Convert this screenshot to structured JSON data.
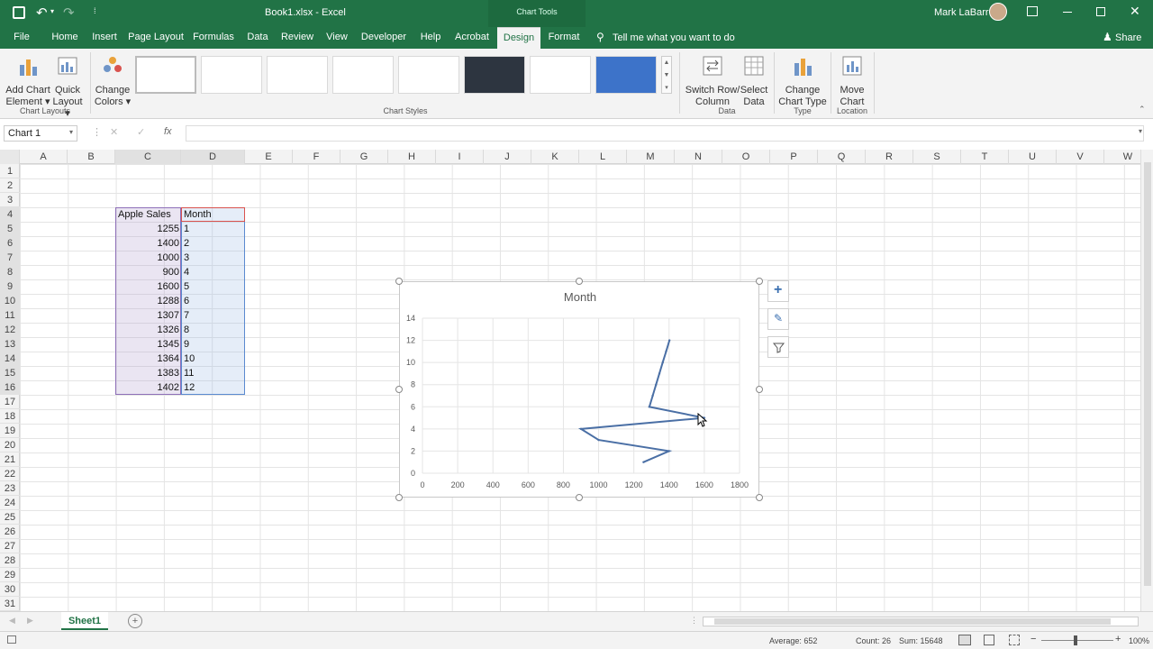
{
  "titlebar": {
    "filename": "Book1.xlsx - Excel",
    "contextual": "Chart Tools",
    "user": "Mark LaBarr"
  },
  "tabs": [
    "File",
    "Home",
    "Insert",
    "Page Layout",
    "Formulas",
    "Data",
    "Review",
    "View",
    "Developer",
    "Help",
    "Acrobat",
    "Design",
    "Format"
  ],
  "tell_me": "Tell me what you want to do",
  "share": "Share",
  "ribbon": {
    "add_chart_element": [
      "Add Chart",
      "Element ▾"
    ],
    "quick_layout": [
      "Quick",
      "Layout ▾"
    ],
    "change_colors": [
      "Change",
      "Colors ▾"
    ],
    "switch_row_column": [
      "Switch Row/",
      "Column"
    ],
    "select_data": [
      "Select",
      "Data"
    ],
    "change_chart_type": [
      "Change",
      "Chart Type"
    ],
    "move_chart": [
      "Move",
      "Chart"
    ],
    "groups": {
      "chart_layouts": "Chart Layouts",
      "chart_styles": "Chart Styles",
      "data": "Data",
      "type": "Type",
      "location": "Location"
    }
  },
  "formula_bar": {
    "name_box": "Chart 1",
    "fx": "fx",
    "value": ""
  },
  "columns": [
    "A",
    "B",
    "C",
    "D",
    "E",
    "F",
    "G",
    "H",
    "I",
    "J",
    "K",
    "L",
    "M",
    "N",
    "O",
    "P",
    "Q",
    "R",
    "S",
    "T",
    "U",
    "V",
    "W"
  ],
  "rows": [
    "1",
    "2",
    "3",
    "4",
    "5",
    "6",
    "7",
    "8",
    "9",
    "10",
    "11",
    "12",
    "13",
    "14",
    "15",
    "16",
    "17",
    "18",
    "19",
    "20",
    "21",
    "22",
    "23",
    "24",
    "25",
    "26",
    "27",
    "28",
    "29",
    "30",
    "31"
  ],
  "table": {
    "header_c": "Apple Sales",
    "header_d": "Month",
    "sales": [
      "1255",
      "1400",
      "1000",
      "900",
      "1600",
      "1288",
      "1307",
      "1326",
      "1345",
      "1364",
      "1383",
      "1402"
    ],
    "months": [
      "1",
      "2",
      "3",
      "4",
      "5",
      "6",
      "7",
      "8",
      "9",
      "10",
      "11",
      "12"
    ]
  },
  "sheet_tab": "Sheet1",
  "status": {
    "average": "Average: 652",
    "count": "Count: 26",
    "sum": "Sum: 15648",
    "zoom": "100%"
  },
  "chart_data": {
    "type": "line",
    "title": "Month",
    "x": [
      1255,
      1400,
      1000,
      900,
      1600,
      1288,
      1307,
      1326,
      1345,
      1364,
      1383,
      1402
    ],
    "y": [
      1,
      2,
      3,
      4,
      5,
      6,
      7,
      8,
      9,
      10,
      11,
      12
    ],
    "xlim": [
      0,
      1800
    ],
    "ylim": [
      0,
      14
    ],
    "xticks": [
      "0",
      "200",
      "400",
      "600",
      "800",
      "1000",
      "1200",
      "1400",
      "1600",
      "1800"
    ],
    "yticks": [
      "0",
      "2",
      "4",
      "6",
      "8",
      "10",
      "12",
      "14"
    ],
    "grid": true,
    "series_color": "#4a6fa5"
  }
}
